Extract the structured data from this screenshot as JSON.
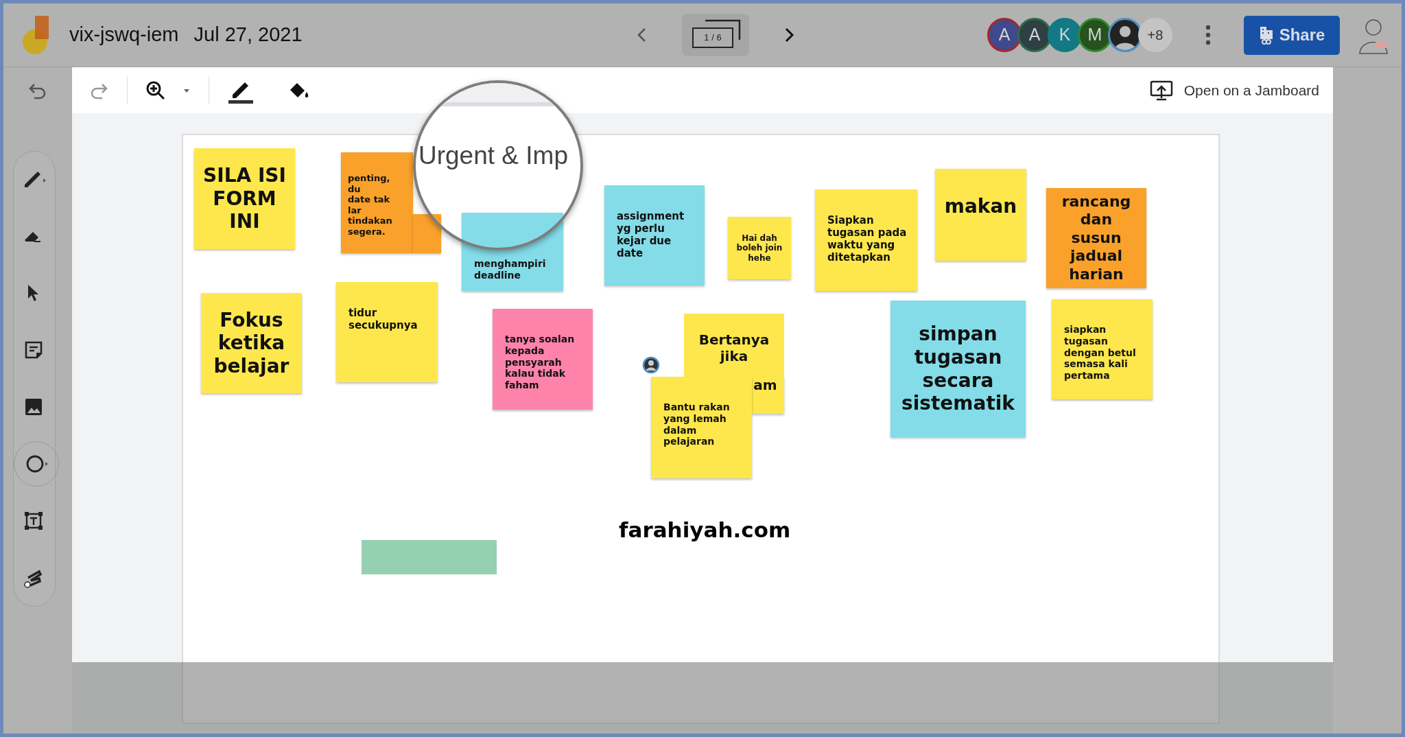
{
  "app": {
    "title": "vix-jswq-iem",
    "date": "Jul 27, 2021"
  },
  "frame_nav": {
    "counter": "1 / 6"
  },
  "collaborators": [
    {
      "kind": "initial",
      "label": "A",
      "color": "#3f4a8c"
    },
    {
      "kind": "initial",
      "label": "A",
      "color": "#2e4044"
    },
    {
      "kind": "initial",
      "label": "K",
      "color": "#127985"
    },
    {
      "kind": "initial",
      "label": "M",
      "color": "#27511d"
    },
    {
      "kind": "photo"
    },
    {
      "kind": "count",
      "label": "+8",
      "color": "#c4c4c4"
    }
  ],
  "share_button": "Share",
  "toolbar": {
    "open_on_jamboard": "Open on a Jamboard"
  },
  "tools": [
    {
      "selected": false
    },
    {
      "selected": false
    },
    {
      "selected": false
    },
    {
      "selected": false
    },
    {
      "selected": false
    },
    {
      "selected": true
    },
    {
      "selected": false
    },
    {
      "selected": false
    }
  ],
  "notes": [
    {
      "kind": "note",
      "text": "SILA ISI FORM INI",
      "color": "#fde74c"
    },
    {
      "kind": "note",
      "text": "penting, du\ndate tak lar\ntindakan\nsegera.",
      "color": "#f9a12b"
    },
    {
      "kind": "note",
      "text": "menghampiri\ndeadline",
      "color": "#83dce8"
    },
    {
      "kind": "note",
      "text": "assignment yg perlu kejar due date",
      "color": "#83dce8"
    },
    {
      "kind": "note",
      "text": "Hai dah boleh join hehe",
      "color": "#fde74c"
    },
    {
      "kind": "note",
      "text": "Siapkan tugasan pada waktu yang ditetapkan",
      "color": "#fde74c"
    },
    {
      "kind": "note",
      "text": "makan",
      "color": "#fde74c"
    },
    {
      "kind": "note",
      "text": "rancang dan susun jadual harian",
      "color": "#f9a12b"
    },
    {
      "kind": "note",
      "text": "Fokus ketika belajar",
      "color": "#fde74c"
    },
    {
      "kind": "note",
      "text": "tidur secukupnya",
      "color": "#fde74c"
    },
    {
      "kind": "note",
      "text": "tanya soalan kepada pensyarah kalau tidak faham",
      "color": "#fd83ab"
    },
    {
      "kind": "note",
      "text": "Bertanya\njika",
      "fragment": "am",
      "color": "#fde74c"
    },
    {
      "kind": "note",
      "text": "Bantu rakan yang lemah dalam pelajaran",
      "color": "#fde74c"
    },
    {
      "kind": "note",
      "text": "simpan tugasan secara sistematik",
      "color": "#83dce8"
    },
    {
      "kind": "note",
      "text": "siapkan tugasan dengan betul semasa kali pertama",
      "color": "#fde74c"
    },
    {
      "kind": "rectangle",
      "color": "#95d0b0"
    }
  ],
  "magnifier": {
    "text": "Urgent & Imp"
  },
  "caption": "farahiyah.com"
}
